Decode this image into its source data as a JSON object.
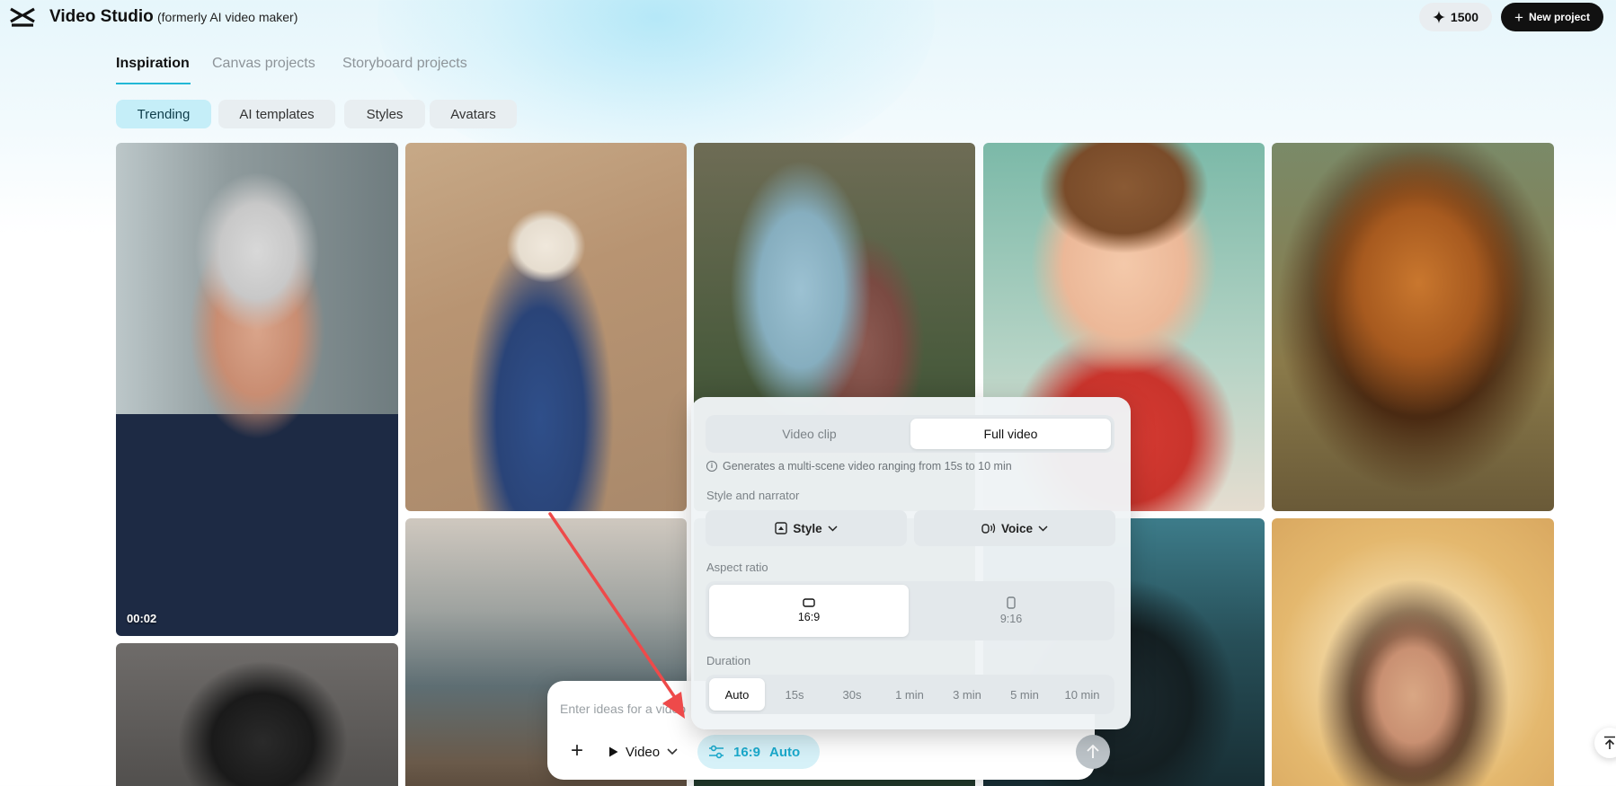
{
  "app": {
    "title": "Video Studio",
    "subtitle": "(formerly AI video maker)",
    "credits": "1500",
    "new_project_label": "New project"
  },
  "tabs": [
    {
      "label": "Inspiration",
      "active": true
    },
    {
      "label": "Canvas projects",
      "active": false
    },
    {
      "label": "Storyboard projects",
      "active": false
    }
  ],
  "chips": [
    {
      "label": "Trending",
      "active": true
    },
    {
      "label": "AI templates",
      "active": false
    },
    {
      "label": "Styles",
      "active": false
    },
    {
      "label": "Avatars",
      "active": false
    }
  ],
  "gallery": {
    "cards": [
      {
        "name": "elderly-businessman",
        "duration": "00:02"
      },
      {
        "name": "man-dark-hair"
      },
      {
        "name": "robed-man-pyramid"
      },
      {
        "name": "coastal-scene"
      },
      {
        "name": "comic-couple"
      },
      {
        "name": "jungle-scene"
      },
      {
        "name": "cartoon-boy"
      },
      {
        "name": "dark-creature"
      },
      {
        "name": "lion"
      },
      {
        "name": "radiant-figure"
      }
    ]
  },
  "settings_popover": {
    "mode_options": [
      {
        "label": "Video clip",
        "active": false
      },
      {
        "label": "Full video",
        "active": true
      }
    ],
    "info_text": "Generates a multi-scene video ranging from 15s to 10 min",
    "style_narrator_label": "Style and narrator",
    "style_button": "Style",
    "voice_button": "Voice",
    "aspect_ratio_label": "Aspect ratio",
    "aspect_ratios": [
      {
        "label": "16:9",
        "active": true
      },
      {
        "label": "9:16",
        "active": false
      }
    ],
    "duration_label": "Duration",
    "durations": [
      {
        "label": "Auto",
        "active": true
      },
      {
        "label": "15s",
        "active": false
      },
      {
        "label": "30s",
        "active": false
      },
      {
        "label": "1 min",
        "active": false
      },
      {
        "label": "3 min",
        "active": false
      },
      {
        "label": "5 min",
        "active": false
      },
      {
        "label": "10 min",
        "active": false
      }
    ]
  },
  "prompt_bar": {
    "placeholder": "Enter ideas for a video",
    "mode": "Video",
    "selected_ratio": "16:9",
    "selected_duration": "Auto"
  },
  "colors": {
    "accent": "#22b8d6",
    "annotation_arrow": "#ee4a4a"
  }
}
